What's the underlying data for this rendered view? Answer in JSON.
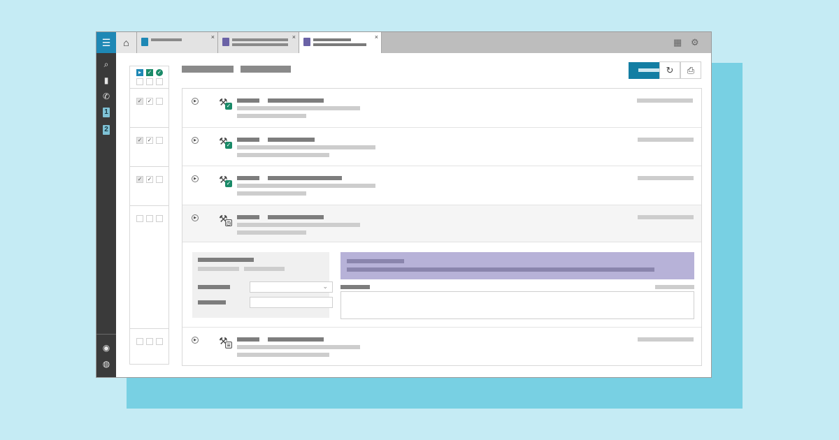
{
  "colors": {
    "background": "#c5ebf4",
    "backdrop": "#78d0e3",
    "accent": "#137ea3",
    "rail": "#3a3a3a",
    "success": "#1a8a68",
    "notice": "#b7b2d8"
  },
  "rail": {
    "icons": [
      "menu-icon",
      "search-icon",
      "clipboard-icon",
      "phone-user-icon",
      "badge-1-icon",
      "badge-2-icon",
      "circle-badge-icon",
      "compass-icon"
    ],
    "badge_1": "1",
    "badge_2": "2"
  },
  "tabbar": {
    "home_icon": "home-icon",
    "tabs": [
      {
        "icon": "list-icon",
        "color": "#1e88b5",
        "close": "×"
      },
      {
        "icon": "document-icon",
        "color": "#6a62a6",
        "close": "×"
      },
      {
        "icon": "checklist-icon",
        "color": "#6a62a6",
        "close": "×",
        "active": true
      }
    ],
    "right_icons": [
      "calendar-icon",
      "user-settings-icon"
    ]
  },
  "header": {
    "actions": [
      "refresh-icon",
      "print-icon"
    ]
  },
  "list": {
    "rows": [
      {
        "status": "done",
        "expanded": false
      },
      {
        "status": "done",
        "expanded": false
      },
      {
        "status": "done",
        "expanded": false
      },
      {
        "status": "pending",
        "expanded": true
      },
      {
        "status": "pending-list",
        "expanded": false
      }
    ]
  },
  "checkbox_column": {
    "header_icons": [
      "play-icon",
      "check-icon",
      "circle-check-icon"
    ],
    "rows": [
      {
        "checks": [
          true,
          true,
          false
        ]
      },
      {
        "checks": [
          true,
          true,
          false
        ]
      },
      {
        "checks": [
          true,
          true,
          false
        ]
      },
      {
        "checks": [
          false,
          false,
          false
        ]
      },
      {
        "checks": [
          false,
          false,
          false
        ]
      }
    ]
  },
  "glyphs": {
    "menu": "☰",
    "search": "⌕",
    "clipboard": "▮",
    "phone": "✆",
    "circle": "◉",
    "compass": "◍",
    "home": "⌂",
    "close": "×",
    "calendar": "▦",
    "user": "⚙",
    "refresh": "↻",
    "print": "⎙",
    "play": "▸",
    "check": "✓",
    "hammer": "⚒",
    "chevron": "⌄",
    "expand": "▶",
    "hourglass": "◷",
    "list": "≡"
  }
}
